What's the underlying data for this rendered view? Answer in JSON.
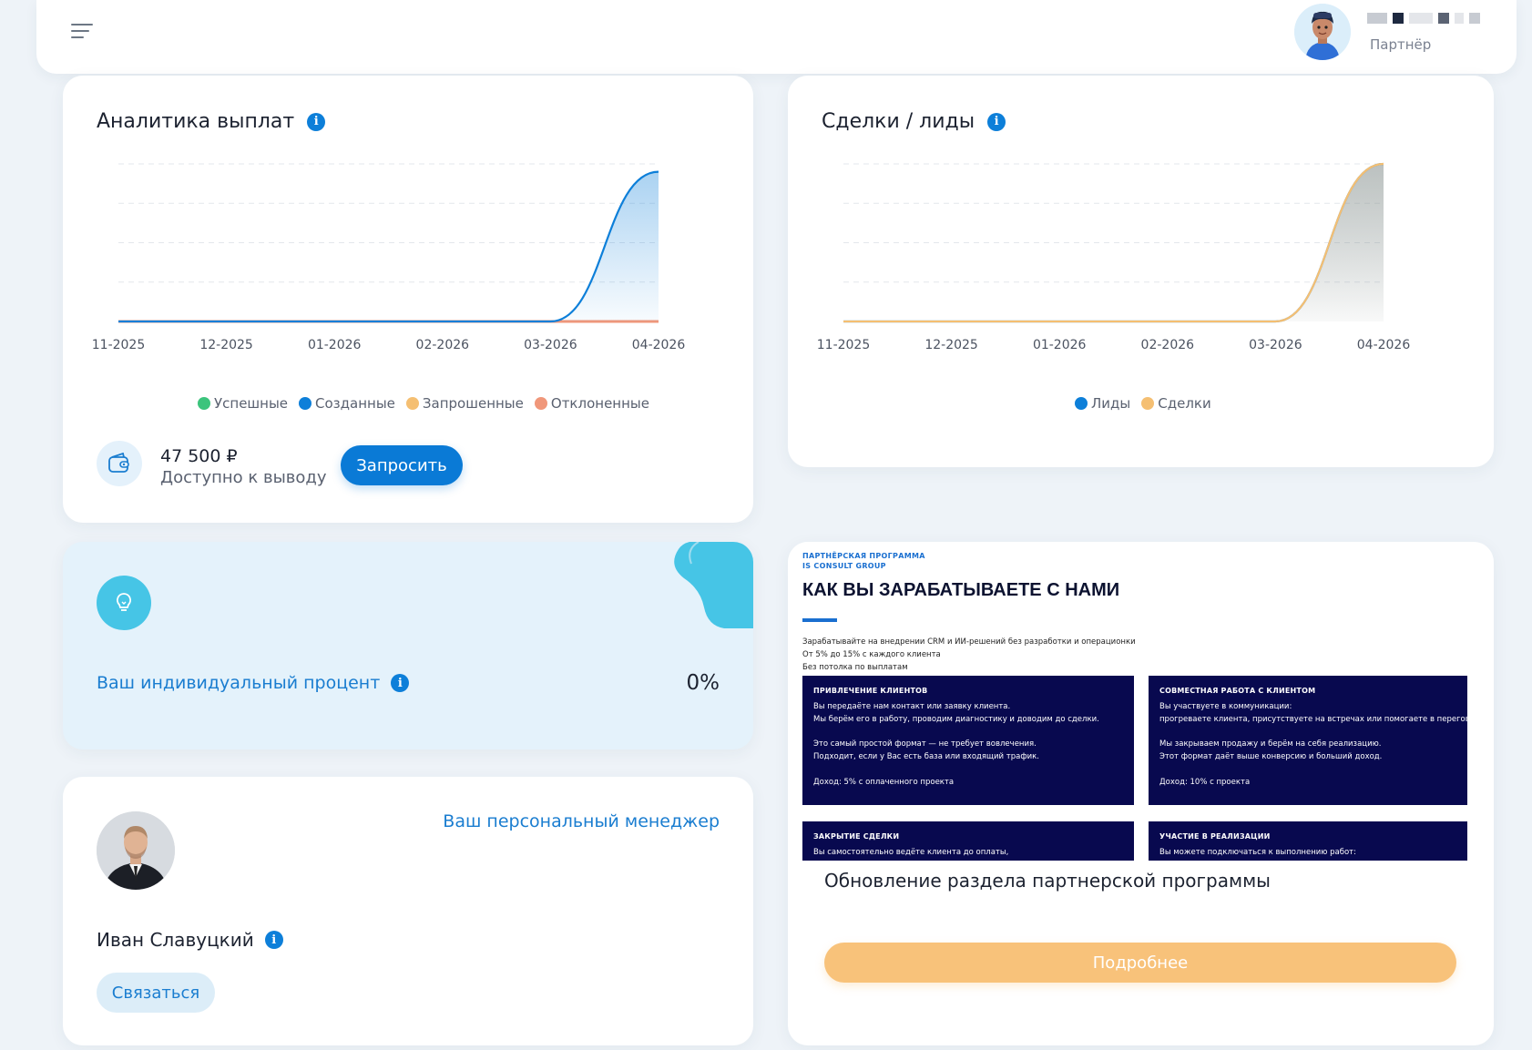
{
  "header": {
    "user_role": "Партнёр"
  },
  "payouts": {
    "title": "Аналитика выплат",
    "balance_amount": "47 500 ₽",
    "balance_caption": "Доступно к выводу",
    "request_label": "Запросить",
    "legend": [
      {
        "label": "Успешные",
        "color": "#3cc47c"
      },
      {
        "label": "Созданные",
        "color": "#0d7fd9"
      },
      {
        "label": "Запрошенные",
        "color": "#f5bf72"
      },
      {
        "label": "Отклоненные",
        "color": "#f0977a"
      }
    ]
  },
  "deals": {
    "title": "Сделки / лиды",
    "legend": [
      {
        "label": "Лиды",
        "color": "#0d7fd9"
      },
      {
        "label": "Сделки",
        "color": "#f5bf72"
      }
    ]
  },
  "percent": {
    "label": "Ваш индивидуальный процент",
    "value": "0%"
  },
  "manager": {
    "link_label": "Ваш персональный менеджер",
    "name": "Иван Славуцкий",
    "contact_label": "Связаться"
  },
  "promo": {
    "kicker_line1": "ПАРТНЁРСКАЯ ПРОГРАММА",
    "kicker_line2": "IS CONSULT GROUP",
    "heading": "КАК ВЫ ЗАРАБАТЫВАЕТЕ С НАМИ",
    "intro": [
      "Зарабатывайте на внедрении CRM и ИИ-решений без разработки и операционки",
      "От 5% до 15% с каждого клиента",
      "Без потолка по выплатам"
    ],
    "boxes": [
      {
        "title": "ПРИВЛЕЧЕНИЕ КЛИЕНТОВ",
        "lines": [
          "Вы передаёте нам контакт или заявку клиента.",
          "Мы берём его в работу, проводим диагностику и доводим до сделки.",
          "",
          "Это самый простой формат — не требует вовлечения.",
          "Подходит, если у Вас есть база или входящий трафик.",
          "",
          "Доход: 5% с оплаченного проекта"
        ]
      },
      {
        "title": "СОВМЕСТНАЯ РАБОТА С КЛИЕНТОМ",
        "lines": [
          "Вы участвуете в коммуникации:",
          "прогреваете клиента, присутствуете на встречах или помогаете в переговорах.",
          "",
          "Мы закрываем продажу и берём на себя реализацию.",
          "Этот формат даёт выше конверсию и больший доход.",
          "",
          "Доход: 10% с проекта"
        ]
      },
      {
        "title": "ЗАКРЫТИЕ СДЕЛКИ",
        "lines": [
          "Вы самостоятельно ведёте клиента до оплаты,"
        ]
      },
      {
        "title": "УЧАСТИЕ В РЕАЛИЗАЦИИ",
        "lines": [
          "Вы можете подключаться к выполнению работ:"
        ]
      }
    ],
    "title": "Обновление раздела партнерской программы",
    "more_label": "Подробнее"
  },
  "chart_data": [
    {
      "type": "area",
      "title": "Аналитика выплат",
      "categories": [
        "11-2025",
        "12-2025",
        "01-2026",
        "02-2026",
        "03-2026",
        "04-2026"
      ],
      "series": [
        {
          "name": "Успешные",
          "color": "#3cc47c",
          "values": [
            0,
            0,
            0,
            0,
            0,
            0
          ]
        },
        {
          "name": "Созданные",
          "color": "#0d7fd9",
          "values": [
            0,
            0,
            0,
            0,
            0,
            47500
          ]
        },
        {
          "name": "Запрошенные",
          "color": "#f5bf72",
          "values": [
            0,
            0,
            0,
            0,
            0,
            0
          ]
        },
        {
          "name": "Отклоненные",
          "color": "#f0977a",
          "values": [
            0,
            0,
            0,
            0,
            0,
            0
          ]
        }
      ],
      "ylim": [
        0,
        50000
      ],
      "grid": true,
      "legend": "bottom"
    },
    {
      "type": "area",
      "title": "Сделки / лиды",
      "categories": [
        "11-2025",
        "12-2025",
        "01-2026",
        "02-2026",
        "03-2026",
        "04-2026"
      ],
      "series": [
        {
          "name": "Лиды",
          "color": "#0d7fd9",
          "values": [
            0,
            0,
            0,
            0,
            0,
            1
          ]
        },
        {
          "name": "Сделки",
          "color": "#f5bf72",
          "values": [
            0,
            0,
            0,
            0,
            0,
            1
          ]
        }
      ],
      "ylim": [
        0,
        1
      ],
      "grid": true,
      "legend": "bottom"
    }
  ]
}
